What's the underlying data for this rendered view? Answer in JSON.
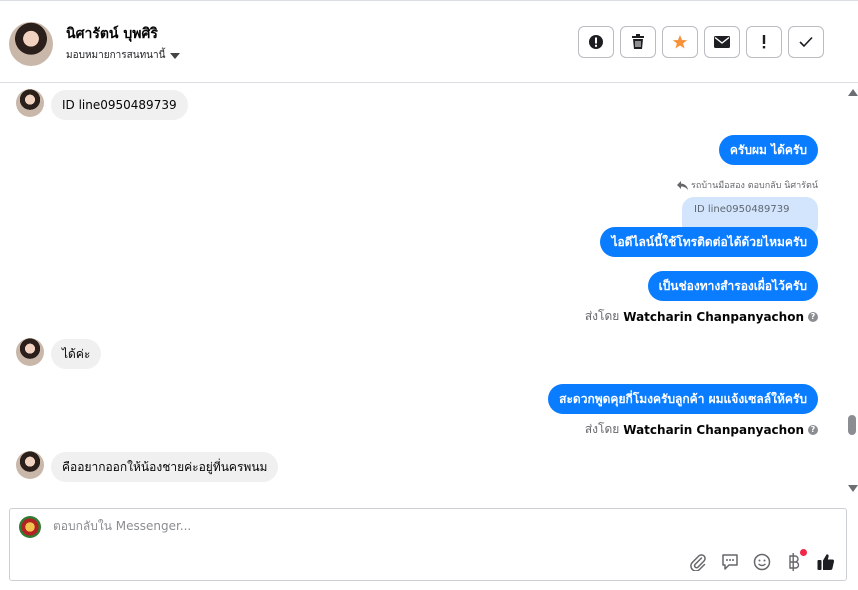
{
  "header": {
    "contact_name": "นิศารัตน์ บุพศิริ",
    "assign_label": "มอบหมายการสนทนานี้",
    "actions": [
      {
        "name": "mark-spam-button",
        "icon": "alert-circle-icon"
      },
      {
        "name": "delete-button",
        "icon": "trash-icon"
      },
      {
        "name": "star-button",
        "icon": "star-icon"
      },
      {
        "name": "mark-unread-button",
        "icon": "envelope-icon"
      },
      {
        "name": "follow-up-button",
        "icon": "exclamation-icon"
      },
      {
        "name": "mark-done-button",
        "icon": "checkmark-icon"
      }
    ]
  },
  "messages": [
    {
      "id": "m1",
      "direction": "in",
      "text": "ID line0950489739"
    },
    {
      "id": "m2",
      "direction": "out",
      "text": "ครับผม ได้ครับ"
    },
    {
      "id": "m3",
      "direction": "out",
      "reply_note": "รถบ้านมือสอง ตอบกลับ นิศารัตน์",
      "quoted": "ID line0950489739",
      "text": "ไอดีไลน์นี้ใช้โทรติดต่อได้ด้วยไหมครับ"
    },
    {
      "id": "m4",
      "direction": "out",
      "text": "เป็นช่องทางสำรองเผื่อไว้ครับ",
      "sent_by_prefix": "ส่งโดย",
      "sent_by_name": "Watcharin Chanpanyachon"
    },
    {
      "id": "m5",
      "direction": "in",
      "text": "ได้ค่ะ"
    },
    {
      "id": "m6",
      "direction": "out",
      "text": "สะดวกพูดคุยกี่โมงครับลูกค้า ผมแจ้งเซลล์ให้ครับ",
      "sent_by_prefix": "ส่งโดย",
      "sent_by_name": "Watcharin Chanpanyachon"
    },
    {
      "id": "m7",
      "direction": "in",
      "text": "คืออยากออกให้น้องชายค่ะอยู่ที่นครพนม"
    }
  ],
  "composer": {
    "placeholder": "ตอบกลับใน Messenger...",
    "tools": [
      "paperclip-icon",
      "chat-bubble-icon",
      "emoji-icon",
      "baht-icon",
      "thumbs-up-icon"
    ]
  },
  "colors": {
    "accent": "#0a7cff",
    "star": "#f7923b",
    "incoming_bubble": "#f0f0f0",
    "quoted_bubble": "#d3e5fc",
    "notification_dot": "#f02849"
  }
}
